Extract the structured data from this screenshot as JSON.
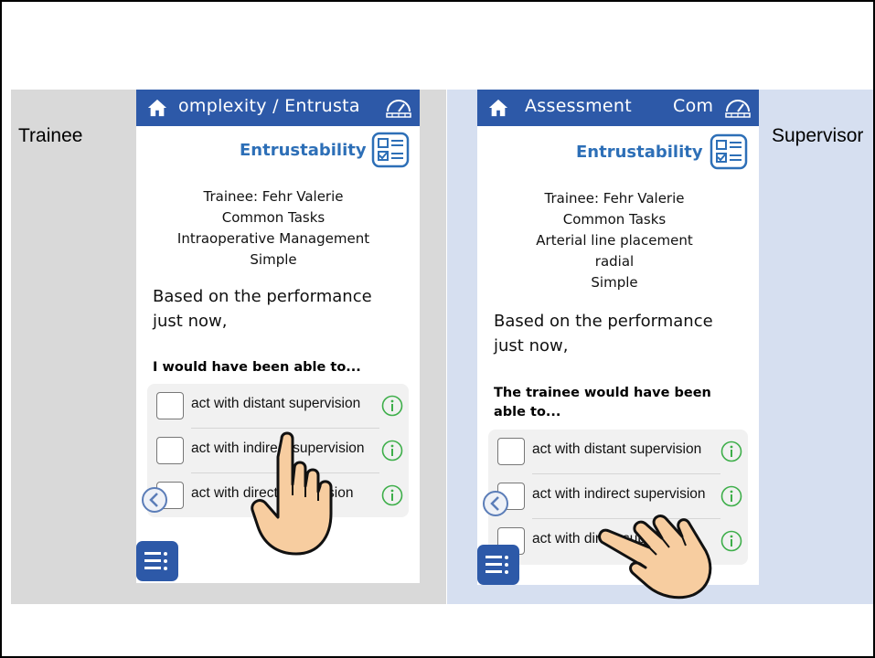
{
  "labels": {
    "left": "Trainee",
    "right": "Supervisor"
  },
  "colors": {
    "nav": "#2d59a8",
    "accent": "#2d6fb7",
    "info_green": "#3dae49",
    "band_left": "#d9d9d9",
    "band_right": "#d6dff0"
  },
  "trainee_screen": {
    "nav_title": "omplexity / Entrusta",
    "header_title": "Entrustability",
    "info_lines": [
      "Trainee: Fehr Valerie",
      "Common Tasks",
      "Intraoperative Management",
      "Simple"
    ],
    "based_on": "Based on the performance just now,",
    "question": "I would have been able to...",
    "options": [
      {
        "label": "act with distant supervision",
        "checked": false
      },
      {
        "label": "act with indirect supervision",
        "checked": false
      },
      {
        "label": "act with direct supervision",
        "checked": false
      }
    ]
  },
  "supervisor_screen": {
    "nav_title": "Assessment",
    "nav_title_2": "Com",
    "header_title": "Entrustability",
    "info_lines": [
      "Trainee: Fehr Valerie",
      "Common Tasks",
      "Arterial line placement",
      "radial",
      "Simple"
    ],
    "based_on": "Based on the performance just now,",
    "question": "The trainee would have been able to...",
    "options": [
      {
        "label": "act with distant supervision",
        "checked": false
      },
      {
        "label": "act with indirect supervision",
        "checked": false
      },
      {
        "label": "act with direct supervision",
        "checked": false
      }
    ]
  },
  "icons": {
    "home": "home-icon",
    "gauge": "gauge-icon",
    "checklist": "checklist-icon",
    "info": "info-icon",
    "back": "chevron-left-icon",
    "menu": "menu-icon",
    "hand": "hand-pointer-icon"
  }
}
